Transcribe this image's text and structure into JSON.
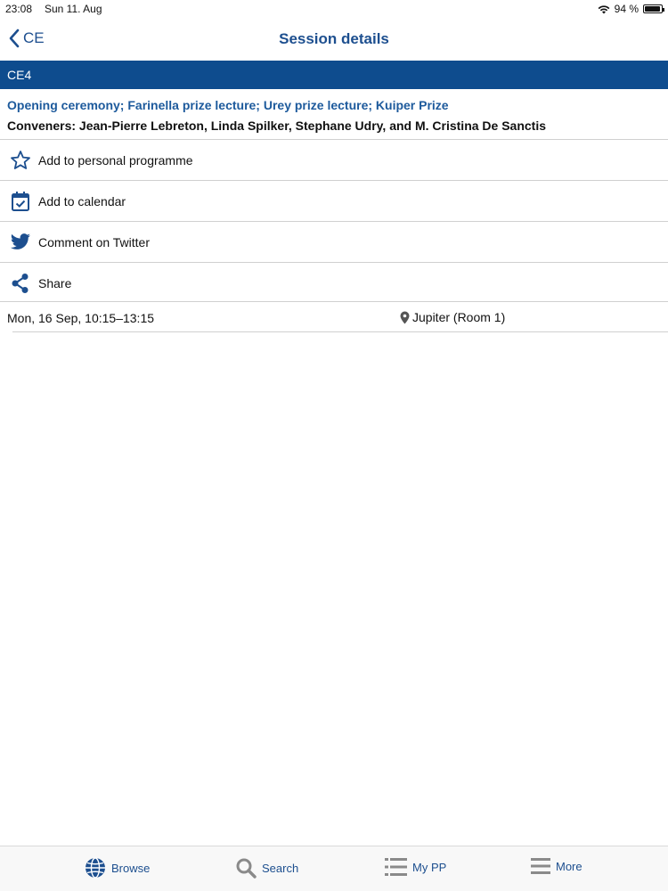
{
  "status_bar": {
    "time": "23:08",
    "date": "Sun 11. Aug",
    "battery": "94 %",
    "battery_level": 0.94
  },
  "nav": {
    "back_label": "CE",
    "title": "Session details"
  },
  "session": {
    "code": "CE4",
    "title": "Opening ceremony; Farinella prize lecture; Urey prize lecture; Kuiper Prize",
    "conveners": "Conveners: Jean-Pierre Lebreton, Linda Spilker, Stephane Udry, and M. Cristina De Sanctis"
  },
  "actions": [
    {
      "label": "Add to personal programme",
      "icon": "star-icon"
    },
    {
      "label": "Add to calendar",
      "icon": "calendar-check-icon"
    },
    {
      "label": "Comment on Twitter",
      "icon": "twitter-icon"
    },
    {
      "label": "Share",
      "icon": "share-icon"
    }
  ],
  "info": {
    "datetime": "Mon, 16 Sep, 10:15–13:15",
    "location": "Jupiter (Room 1)"
  },
  "tabs": [
    {
      "label": "Browse",
      "icon": "globe-icon"
    },
    {
      "label": "Search",
      "icon": "search-icon"
    },
    {
      "label": "My PP",
      "icon": "list-icon"
    },
    {
      "label": "More",
      "icon": "menu-icon"
    }
  ],
  "colors": {
    "accent": "#1d4f8f",
    "band": "#0e4c8e"
  }
}
